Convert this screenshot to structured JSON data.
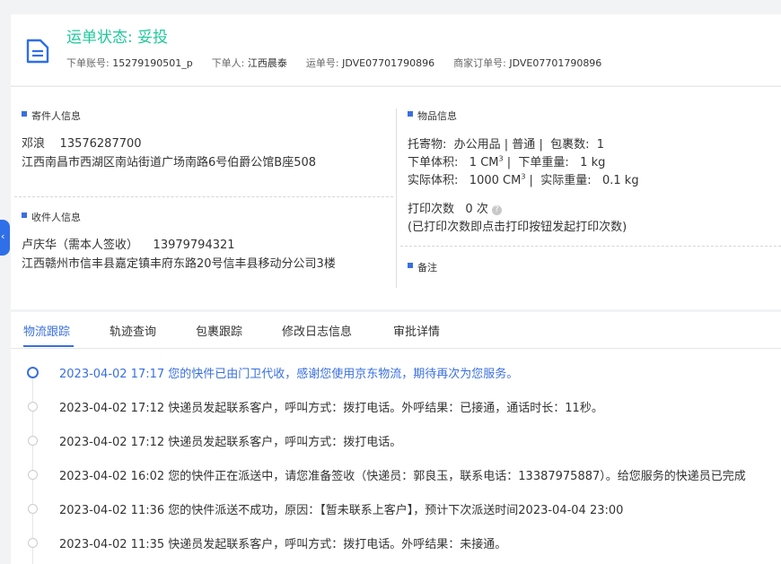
{
  "header": {
    "status_title": "运单状态: 妥投",
    "account_label": "下单账号:",
    "account_value": "15279190501_p",
    "placer_label": "下单人:",
    "placer_value": "江西晨泰",
    "waybill_label": "运单号:",
    "waybill_value": "JDVE07701790896",
    "merchant_order_label": "商家订单号:",
    "merchant_order_value": "JDVE07701790896"
  },
  "sender": {
    "title": "寄件人信息",
    "name": "邓浪",
    "phone": "13576287700",
    "address": "江西南昌市西湖区南站街道广场南路6号伯爵公馆B座508"
  },
  "receiver": {
    "title": "收件人信息",
    "name": "卢庆华（需本人签收）",
    "phone": "13979794321",
    "address": "江西赣州市信丰县嘉定镇丰府东路20号信丰县移动分公司3楼"
  },
  "goods": {
    "title": "物品信息",
    "goods_label": "托寄物:",
    "goods_value": "办公用品 | 普通",
    "pkg_label": "包裹数:",
    "pkg_value": "1",
    "order_volume_label": "下单体积:",
    "order_volume_value": "1 CM",
    "order_weight_label": "下单重量:",
    "order_weight_value": "1 kg",
    "actual_volume_label": "实际体积:",
    "actual_volume_value": "1000 CM",
    "actual_weight_label": "实际重量:",
    "actual_weight_value": "0.1 kg",
    "print_label": "打印次数",
    "print_value": "0 次",
    "print_note": "(已打印次数即点击打印按钮发起打印次数)",
    "remark_title": "备注"
  },
  "tabs": [
    "物流跟踪",
    "轨迹查询",
    "包裹跟踪",
    "修改日志信息",
    "审批详情"
  ],
  "timeline": [
    "2023-04-02 17:17 您的快件已由门卫代收，感谢您使用京东物流，期待再次为您服务。",
    "2023-04-02 17:12 快递员发起联系客户，呼叫方式：拨打电话。外呼结果：已接通，通话时长：11秒。",
    "2023-04-02 17:12 快递员发起联系客户，呼叫方式：拨打电话。",
    "2023-04-02 16:02 您的快件正在派送中，请您准备签收（快递员：郭良玉，联系电话：13387975887）。给您服务的快递员已完成",
    "2023-04-02 11:36 您的快件派送不成功，原因：【暂未联系上客户】，预计下次派送时间2023-04-04 23:00",
    "2023-04-02 11:35 快递员发起联系客户，呼叫方式：拨打电话。外呼结果：未接通。"
  ],
  "colors": {
    "accent": "#3a6fe0",
    "status_green": "#1ec99b"
  },
  "icons": {
    "status": "document-icon",
    "side_toggle": "chevron-left-icon",
    "help": "question-icon"
  }
}
